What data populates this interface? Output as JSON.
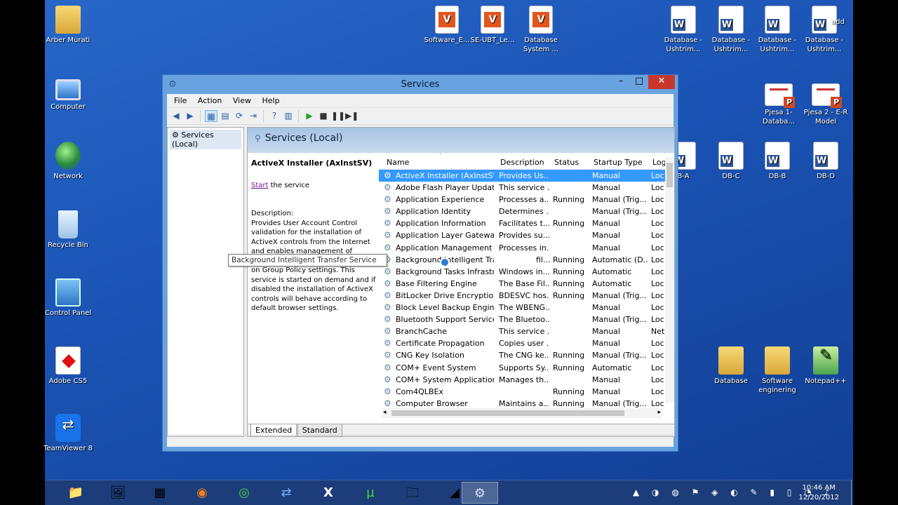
{
  "desktop": {
    "icons": [
      {
        "label": "Arber Murati",
        "type": "folder",
        "icon": "user-folder-icon"
      },
      {
        "label": "Computer",
        "type": "pc",
        "icon": "computer-icon"
      },
      {
        "label": "Network",
        "type": "globe",
        "icon": "network-icon"
      },
      {
        "label": "Recycle Bin",
        "type": "bin",
        "icon": "recycle-bin-icon"
      },
      {
        "label": "Control Panel",
        "type": "cpanel",
        "icon": "control-panel-icon"
      },
      {
        "label": "Adobe CS5",
        "type": "pdf",
        "icon": "adobe-folder-icon"
      },
      {
        "label": "TeamViewer 8",
        "type": "tv",
        "icon": "teamviewer-icon"
      },
      {
        "label": "Software_E...",
        "type": "vc",
        "icon": "visual-paradigm-file-icon"
      },
      {
        "label": "SE-UBT_Le...",
        "type": "vc",
        "icon": "visual-paradigm-file-icon"
      },
      {
        "label": "Database System ...",
        "type": "vc",
        "icon": "visual-paradigm-file-icon"
      },
      {
        "label": "Database - Ushtrim...",
        "type": "word",
        "icon": "word-document-icon"
      },
      {
        "label": "Database - Ushtrim...",
        "type": "word",
        "icon": "word-document-icon"
      },
      {
        "label": "Database - Ushtrim...",
        "type": "word",
        "icon": "word-document-icon"
      },
      {
        "label": "Database - Ushtrim...",
        "type": "word",
        "icon": "word-document-icon"
      },
      {
        "label": "add",
        "type": "none",
        "icon": "partial-icon"
      },
      {
        "label": "Pjesa 1- Databa...",
        "type": "ppt",
        "icon": "powerpoint-file-icon"
      },
      {
        "label": "Pjesa 2 - E-R Model",
        "type": "ppt",
        "icon": "powerpoint-file-icon"
      },
      {
        "label": "B-A",
        "type": "word",
        "icon": "word-document-icon"
      },
      {
        "label": "DB-C",
        "type": "word",
        "icon": "word-document-icon"
      },
      {
        "label": "DB-B",
        "type": "word",
        "icon": "word-document-icon"
      },
      {
        "label": "DB-D",
        "type": "word",
        "icon": "word-document-icon"
      },
      {
        "label": "Database",
        "type": "folder",
        "icon": "folder-icon"
      },
      {
        "label": "Software enginering",
        "type": "folder",
        "icon": "folder-icon"
      },
      {
        "label": "Notepad++",
        "type": "npp",
        "icon": "notepad-plus-plus-icon"
      }
    ]
  },
  "window": {
    "title": "Services",
    "controls": {
      "minimize": "–",
      "maximize": "□",
      "close": "✕"
    },
    "menu": [
      "File",
      "Action",
      "View",
      "Help"
    ],
    "toolbar_icons": [
      "back-icon",
      "forward-icon",
      "sep",
      "console-tree-icon",
      "properties-icon",
      "refresh-icon",
      "export-icon",
      "sep",
      "help-icon",
      "show-hide-icon",
      "sep",
      "start-service-icon",
      "stop-service-icon",
      "pause-service-icon",
      "restart-service-icon"
    ],
    "toolbar_glyphs": [
      "◀",
      "▶",
      "",
      "▦",
      "▤",
      "⟳",
      "⇥",
      "",
      "?",
      "▥",
      "",
      "▶",
      "■",
      "❚❚",
      "▶❚"
    ],
    "nav": {
      "item": "Services (Local)"
    },
    "header": "Services (Local)",
    "detail": {
      "title": "ActiveX Installer (AxInstSV)",
      "start_link": "Start",
      "start_rest": " the service",
      "desc_label": "Description:",
      "desc_text": "Provides User Account Control validation for the installation of ActiveX controls from the Internet and enables management of ActiveX control installation based on Group Policy settings. This service is started on demand and if disabled the installation of ActiveX controls will behave according to default browser settings."
    },
    "columns": {
      "name": "Name",
      "description": "Description",
      "status": "Status",
      "startup": "Startup Type",
      "log": "Log"
    },
    "rows": [
      {
        "name": "ActiveX Installer (AxInstSV)",
        "desc": "Provides Us...",
        "status": "",
        "startup": "Manual",
        "log": "Loc"
      },
      {
        "name": "Adobe Flash Player Update ...",
        "desc": "This service ...",
        "status": "",
        "startup": "Manual",
        "log": "Loc"
      },
      {
        "name": "Application Experience",
        "desc": "Processes a...",
        "status": "Running",
        "startup": "Manual (Trig...",
        "log": "Loc"
      },
      {
        "name": "Application Identity",
        "desc": "Determines ...",
        "status": "",
        "startup": "Manual (Trig...",
        "log": "Loc"
      },
      {
        "name": "Application Information",
        "desc": "Facilitates t...",
        "status": "Running",
        "startup": "Manual",
        "log": "Loc"
      },
      {
        "name": "Application Layer Gateway ...",
        "desc": "Provides su...",
        "status": "",
        "startup": "Manual",
        "log": "Loc"
      },
      {
        "name": "Application Management",
        "desc": "Processes in...",
        "status": "",
        "startup": "Manual",
        "log": "Loc"
      },
      {
        "name": "Background Intelligent Transfer Service",
        "desc": "fil...",
        "status": "Running",
        "startup": "Automatic (D...",
        "log": "Loc"
      },
      {
        "name": "Background Tasks Infrastru...",
        "desc": "Windows in...",
        "status": "Running",
        "startup": "Automatic",
        "log": "Loc"
      },
      {
        "name": "Base Filtering Engine",
        "desc": "The Base Fil...",
        "status": "Running",
        "startup": "Automatic",
        "log": "Loc"
      },
      {
        "name": "BitLocker Drive Encryption ...",
        "desc": "BDESVC hos...",
        "status": "Running",
        "startup": "Manual (Trig...",
        "log": "Loc"
      },
      {
        "name": "Block Level Backup Engine ...",
        "desc": "The WBENG...",
        "status": "",
        "startup": "Manual",
        "log": "Loc"
      },
      {
        "name": "Bluetooth Support Service",
        "desc": "The Bluetoo...",
        "status": "",
        "startup": "Manual (Trig...",
        "log": "Loc"
      },
      {
        "name": "BranchCache",
        "desc": "This service ...",
        "status": "",
        "startup": "Manual",
        "log": "Net"
      },
      {
        "name": "Certificate Propagation",
        "desc": "Copies user ...",
        "status": "",
        "startup": "Manual",
        "log": "Loc"
      },
      {
        "name": "CNG Key Isolation",
        "desc": "The CNG ke...",
        "status": "Running",
        "startup": "Manual (Trig...",
        "log": "Loc"
      },
      {
        "name": "COM+ Event System",
        "desc": "Supports Sy...",
        "status": "Running",
        "startup": "Automatic",
        "log": "Loc"
      },
      {
        "name": "COM+ System Application",
        "desc": "Manages th...",
        "status": "",
        "startup": "Manual",
        "log": "Loc"
      },
      {
        "name": "Com4QLBEx",
        "desc": "",
        "status": "Running",
        "startup": "Manual",
        "log": "Loc"
      },
      {
        "name": "Computer Browser",
        "desc": "Maintains a...",
        "status": "Running",
        "startup": "Manual (Trig...",
        "log": "Loc"
      }
    ],
    "tooltip": "Background Intelligent Transfer Service",
    "tabs": [
      "Extended",
      "Standard"
    ]
  },
  "taskbar": {
    "buttons": [
      {
        "name": "file-explorer-icon",
        "glyph": "📁"
      },
      {
        "name": "windows-photo-icon",
        "glyph": "🖼"
      },
      {
        "name": "firewall-icon",
        "glyph": "▦"
      },
      {
        "name": "firefox-icon",
        "glyph": "◉"
      },
      {
        "name": "razer-icon",
        "glyph": "◎"
      },
      {
        "name": "teamviewer-icon",
        "glyph": "⇄"
      },
      {
        "name": "excel-icon",
        "glyph": "X"
      },
      {
        "name": "utorrent-icon",
        "glyph": "µ"
      },
      {
        "name": "library-icon",
        "glyph": "🗀"
      },
      {
        "name": "visual-paradigm-icon",
        "glyph": "◢"
      },
      {
        "name": "services-icon",
        "glyph": "⚙"
      }
    ],
    "tray_glyphs": "▲ ◑ ◍ ⚑ ◈ ◐ ✎ ▮ ▯ ◔ ♪",
    "time": "10:46 AM",
    "date": "12/20/2012"
  }
}
